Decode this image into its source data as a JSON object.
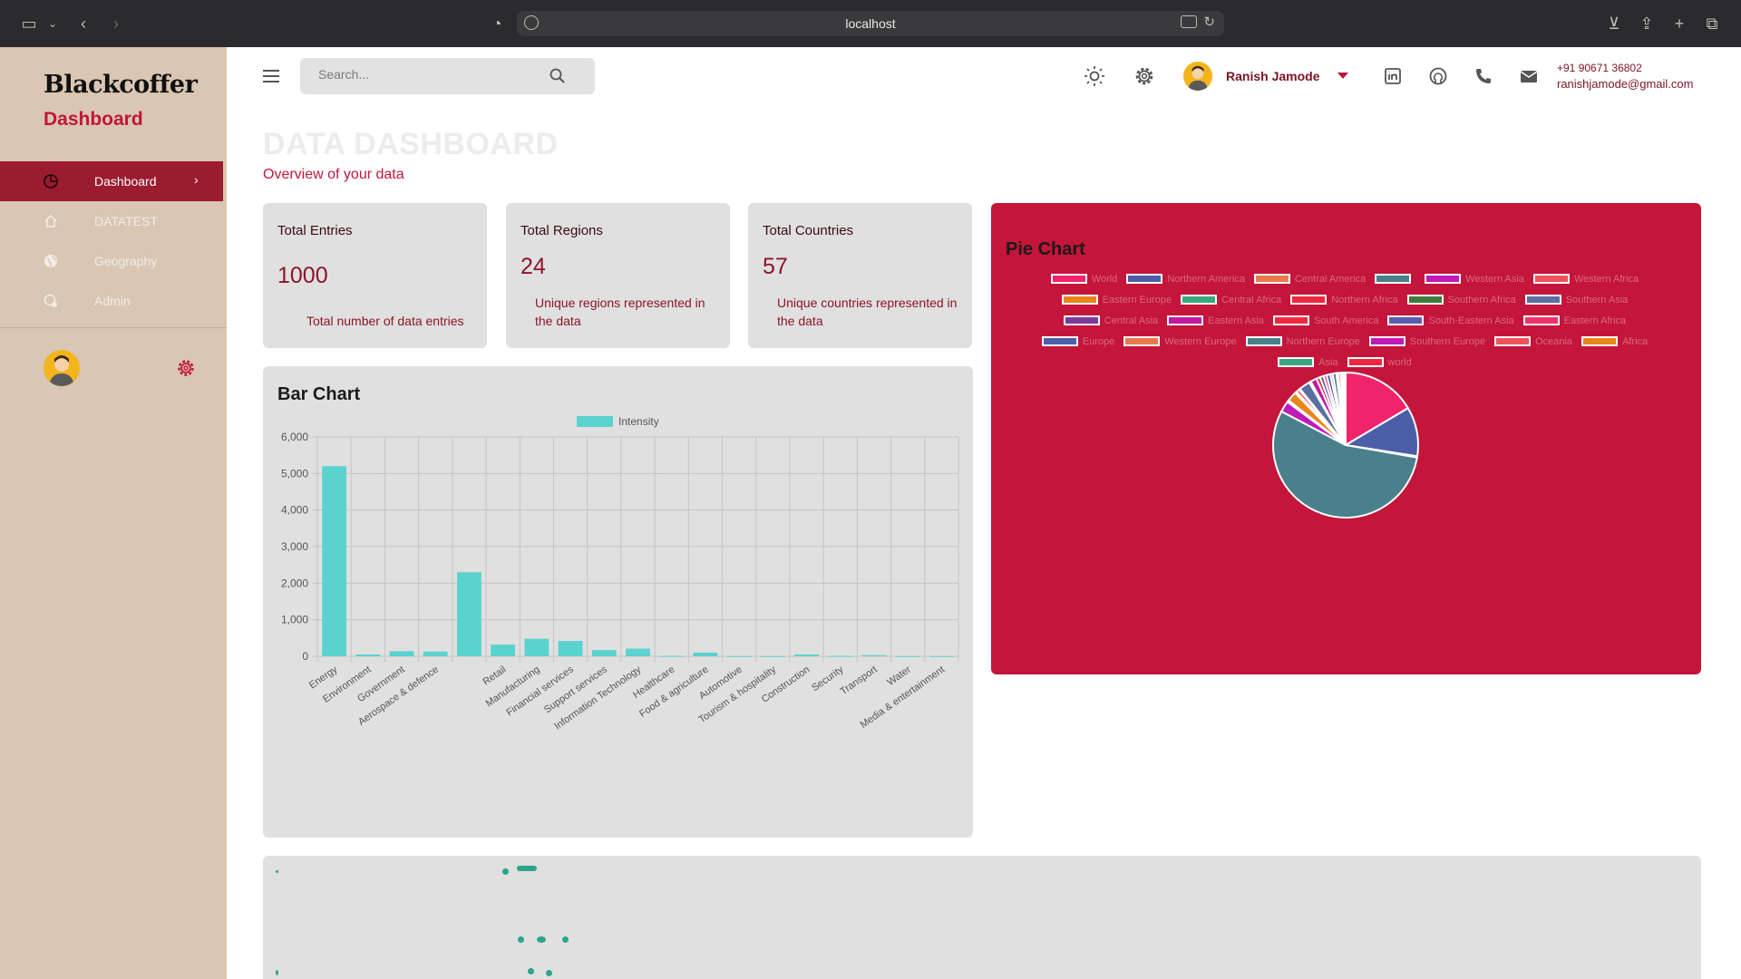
{
  "browser": {
    "url": "localhost"
  },
  "sidebar": {
    "brand": "Blackcoffer",
    "brand_sub": "Dashboard",
    "items": [
      {
        "label": "Dashboard",
        "icon": "pie-icon",
        "active": true
      },
      {
        "label": "DATATEST",
        "icon": "home-icon",
        "active": false
      },
      {
        "label": "Geography",
        "icon": "globe-icon",
        "active": false
      },
      {
        "label": "Admin",
        "icon": "admin-icon",
        "active": false
      }
    ]
  },
  "topbar": {
    "search_placeholder": "Search...",
    "user_name": "Ranish Jamode",
    "phone": "+91 90671 36802",
    "email": "ranishjamode@gmail.com"
  },
  "header": {
    "title": "DATA DASHBOARD",
    "subtitle": "Overview of your data"
  },
  "stats": [
    {
      "title": "Total Entries",
      "value": "1000",
      "desc": "Total number of data entries"
    },
    {
      "title": "Total Regions",
      "value": "24",
      "desc": "Unique regions represented in the data"
    },
    {
      "title": "Total Countries",
      "value": "57",
      "desc": "Unique countries represented in the data"
    }
  ],
  "colors": {
    "accent": "#c0163a",
    "sidebar_bg": "#d9c6b3",
    "bar": "#5ad3cf"
  },
  "bar_chart": {
    "title": "Bar Chart"
  },
  "pie_chart": {
    "title": "Pie Chart"
  },
  "chart_data": [
    {
      "type": "bar",
      "title": "Bar Chart",
      "categories": [
        "Energy",
        "Environment",
        "Government",
        "Aerospace & defence",
        "",
        "Retail",
        "Manufacturing",
        "Financial services",
        "Support services",
        "Information Technology",
        "Healthcare",
        "Food & agriculture",
        "Automotive",
        "Tourism & hospitality",
        "Construction",
        "Security",
        "Transport",
        "Water",
        "Media & entertainment"
      ],
      "series": [
        {
          "name": "Intensity",
          "values": [
            5200,
            50,
            140,
            130,
            2300,
            320,
            480,
            420,
            170,
            210,
            10,
            100,
            5,
            5,
            50,
            10,
            30,
            5,
            5
          ]
        }
      ],
      "ylim": [
        0,
        6000
      ],
      "yticks": [
        "0",
        "1,000",
        "2,000",
        "3,000",
        "4,000",
        "5,000",
        "6,000"
      ],
      "legend_position": "top-center",
      "grid": true
    },
    {
      "type": "pie",
      "title": "Pie Chart",
      "labels": [
        "World",
        "Northern America",
        "Central America",
        "",
        "Western Asia",
        "Western Africa",
        "Eastern Europe",
        "Central Africa",
        "Northern Africa",
        "Southern Africa",
        "Southern Asia",
        "Central Asia",
        "Eastern Asia",
        "South America",
        "South-Eastern Asia",
        "Eastern Africa",
        "Europe",
        "Western Europe",
        "Northern Europe",
        "Southern Europe",
        "Oceania",
        "Africa",
        "Asia",
        "world"
      ],
      "values": [
        120,
        80,
        2,
        400,
        18,
        3,
        16,
        3,
        5,
        2,
        18,
        3,
        10,
        6,
        6,
        5,
        6,
        4,
        6,
        3,
        4,
        3,
        3,
        2
      ],
      "colors": [
        "#f0246a",
        "#4b5ea8",
        "#e8794a",
        "#4a7f8c",
        "#c01ab8",
        "#f0525c",
        "#e8861a",
        "#3aa87e",
        "#f0283e",
        "#3e7a3a",
        "#5a6ea0",
        "#7e3a9a",
        "#c01aa0",
        "#f0283e",
        "#5a5eb0",
        "#f0326a",
        "#4b5ea8",
        "#e8794a",
        "#4a7f8c",
        "#c01ab8",
        "#f0525c",
        "#e8861a",
        "#3aa87e",
        "#f0283e"
      ],
      "legend_position": "top"
    }
  ]
}
